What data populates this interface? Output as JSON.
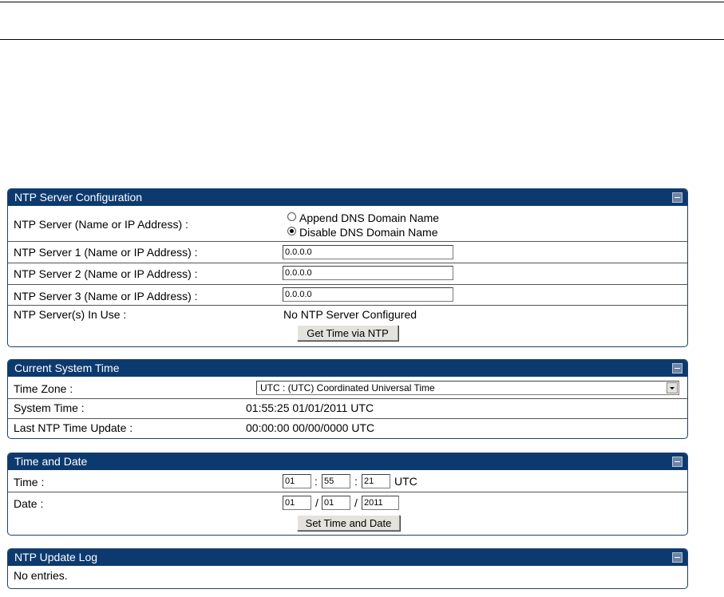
{
  "ntp_config": {
    "title": "NTP Server Configuration",
    "server_label": "NTP Server (Name or IP Address) :",
    "radio_append": "Append DNS Domain Name",
    "radio_disable": "Disable DNS Domain Name",
    "radio_selected": "disable",
    "server1_label": "NTP Server 1 (Name or IP Address) :",
    "server1_value": "0.0.0.0",
    "server2_label": "NTP Server 2 (Name or IP Address) :",
    "server2_value": "0.0.0.0",
    "server3_label": "NTP Server 3 (Name or IP Address) :",
    "server3_value": "0.0.0.0",
    "in_use_label": "NTP Server(s) In Use :",
    "in_use_value": "No NTP Server Configured",
    "get_time_button": "Get Time via NTP"
  },
  "system_time": {
    "title": "Current System Time",
    "timezone_label": "Time Zone :",
    "timezone_value": "UTC : (UTC) Coordinated Universal Time",
    "system_time_label": "System Time :",
    "system_time_value": "01:55:25 01/01/2011 UTC",
    "last_update_label": "Last NTP Time Update :",
    "last_update_value": "00:00:00 00/00/0000 UTC"
  },
  "time_date": {
    "title": "Time and Date",
    "time_label": "Time :",
    "hour": "01",
    "minute": "55",
    "second": "21",
    "time_sep": ":",
    "tz_suffix": "UTC",
    "date_label": "Date :",
    "day": "01",
    "month": "01",
    "year": "2011",
    "date_sep": "/",
    "set_button": "Set Time and Date"
  },
  "update_log": {
    "title": "NTP Update Log",
    "empty_text": "No entries."
  }
}
